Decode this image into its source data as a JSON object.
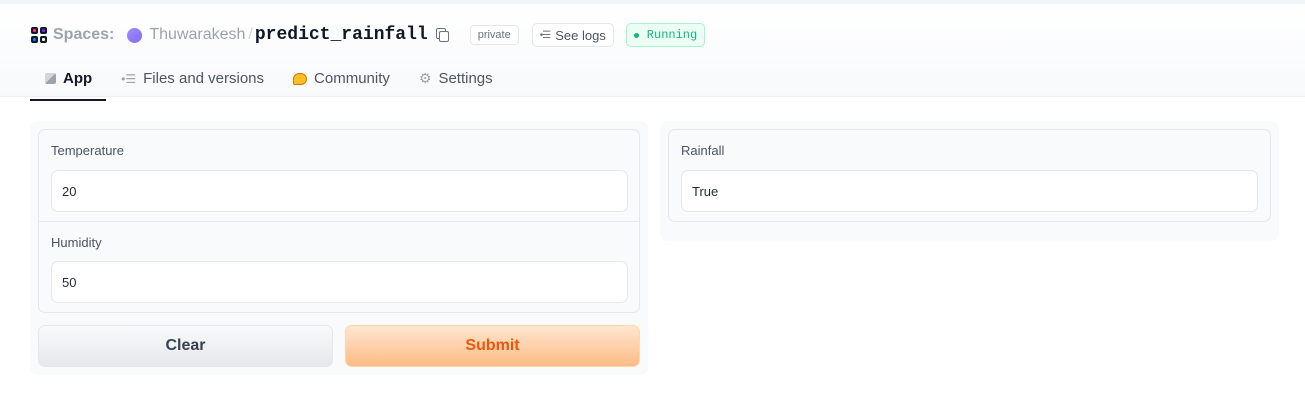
{
  "header": {
    "spaces_label": "Spaces:",
    "owner": "Thuwarakesh",
    "separator": "/",
    "repo_name": "predict_rainfall",
    "visibility_badge": "private",
    "logs_button": "See logs",
    "status": "Running",
    "status_color": "#10b981"
  },
  "tabs": [
    {
      "label": "App",
      "icon": "cube-icon",
      "active": true
    },
    {
      "label": "Files and versions",
      "icon": "files-icon",
      "active": false
    },
    {
      "label": "Community",
      "icon": "community-icon",
      "active": false
    },
    {
      "label": "Settings",
      "icon": "gear-icon",
      "active": false
    }
  ],
  "inputs": {
    "temperature": {
      "label": "Temperature",
      "value": "20"
    },
    "humidity": {
      "label": "Humidity",
      "value": "50"
    }
  },
  "buttons": {
    "clear": "Clear",
    "submit": "Submit",
    "submit_color": "#ea580c"
  },
  "output": {
    "label": "Rainfall",
    "value": "True"
  }
}
